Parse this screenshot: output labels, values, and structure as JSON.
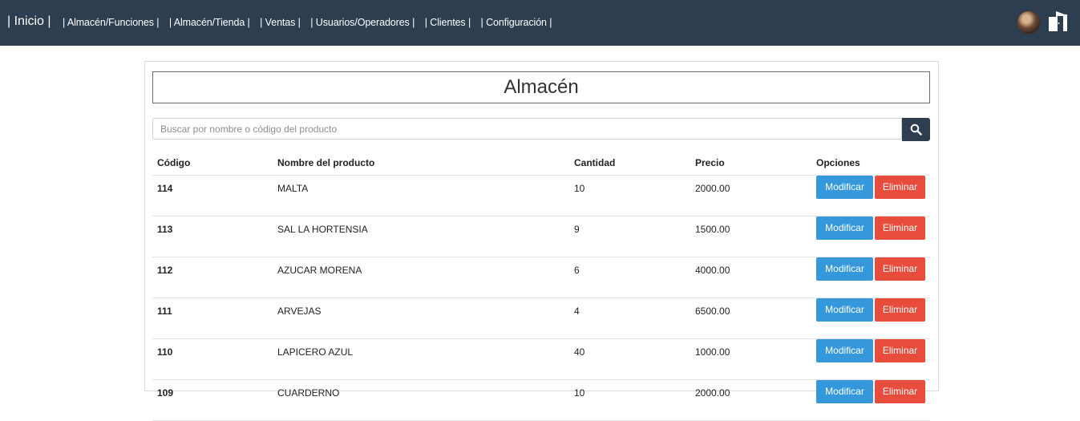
{
  "nav": {
    "brand": "| Inicio |",
    "items": [
      {
        "label": "| Almacén/Funciones |"
      },
      {
        "label": "| Almacén/Tienda |"
      },
      {
        "label": "| Ventas |"
      },
      {
        "label": "| Usuarios/Operadores |"
      },
      {
        "label": "| Clientes |"
      },
      {
        "label": "| Configuración |"
      }
    ],
    "icons": {
      "avatar": "user-avatar",
      "logout": "door-exit-icon"
    },
    "color": "#2c3e50"
  },
  "main": {
    "title": "Almacén",
    "search": {
      "placeholder": "Buscar por nombre o código del producto",
      "value": ""
    },
    "table": {
      "headers": {
        "code": "Código",
        "name": "Nombre del producto",
        "qty": "Cantidad",
        "price": "Precio",
        "options": "Opciones"
      },
      "rows": [
        {
          "code": "114",
          "name": "MALTA",
          "qty": "10",
          "price": "2000.00"
        },
        {
          "code": "113",
          "name": "SAL LA HORTENSIA",
          "qty": "9",
          "price": "1500.00"
        },
        {
          "code": "112",
          "name": "AZUCAR MORENA",
          "qty": "6",
          "price": "4000.00"
        },
        {
          "code": "111",
          "name": "ARVEJAS",
          "qty": "4",
          "price": "6500.00"
        },
        {
          "code": "110",
          "name": "LAPICERO AZUL",
          "qty": "40",
          "price": "1000.00"
        },
        {
          "code": "109",
          "name": "CUARDERNO",
          "qty": "10",
          "price": "2000.00"
        }
      ]
    },
    "actions": {
      "modify": "Modificar",
      "delete": "Eliminar"
    },
    "colors": {
      "modify": "#3498db",
      "delete": "#e74c3c"
    }
  }
}
